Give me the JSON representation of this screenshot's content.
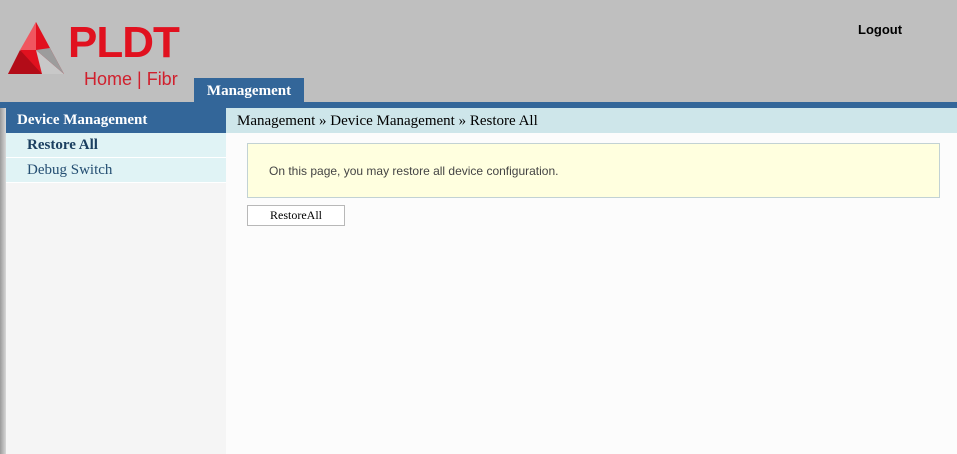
{
  "header": {
    "brand_name": "PLDT",
    "brand_sub": "Home | Fibr",
    "logout_label": "Logout",
    "tabs": [
      {
        "label": "Management",
        "active": true
      }
    ]
  },
  "sidebar": {
    "title": "Device Management",
    "items": [
      {
        "label": "Restore All",
        "active": true
      },
      {
        "label": "Debug Switch",
        "active": false
      }
    ]
  },
  "main": {
    "breadcrumb": "Management » Device Management » Restore All",
    "info_text": "On this page, you may restore all device configuration.",
    "restore_button_label": "RestoreAll"
  },
  "colors": {
    "brand_red": "#e1111f",
    "nav_blue": "#336699",
    "header_gray": "#bfbfbf",
    "breadcrumb_bg": "#cee6ea",
    "info_bg": "#ffffdf"
  }
}
